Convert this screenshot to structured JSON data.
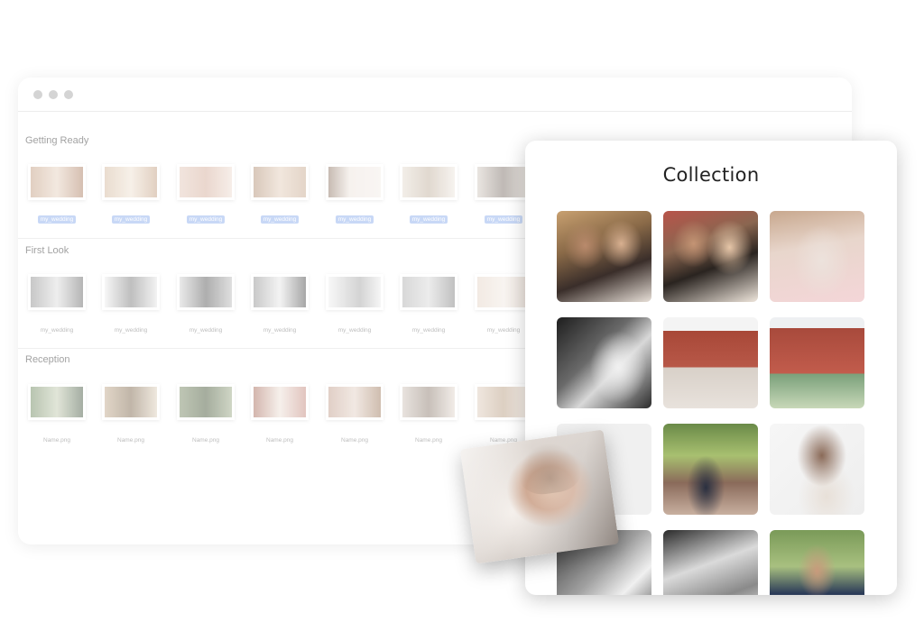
{
  "sections": [
    {
      "title": "Getting Ready",
      "labels": [
        "my_wedding",
        "my_wedding",
        "my_wedding",
        "my_wedding",
        "my_wedding",
        "my_wedding",
        "my_wedding"
      ]
    },
    {
      "title": "First Look",
      "labels": [
        "my_wedding",
        "my_wedding",
        "my_wedding",
        "my_wedding",
        "my_wedding",
        "my_wedding",
        "my_wedding"
      ]
    },
    {
      "title": "Reception",
      "labels": [
        "Name.png",
        "Name.png",
        "Name.png",
        "Name.png",
        "Name.png",
        "Name.png",
        "Name.png"
      ]
    }
  ],
  "collection": {
    "title": "Collection"
  },
  "colors": {
    "tag_background": "#9bb8ef",
    "panel_background": "#ffffff"
  }
}
